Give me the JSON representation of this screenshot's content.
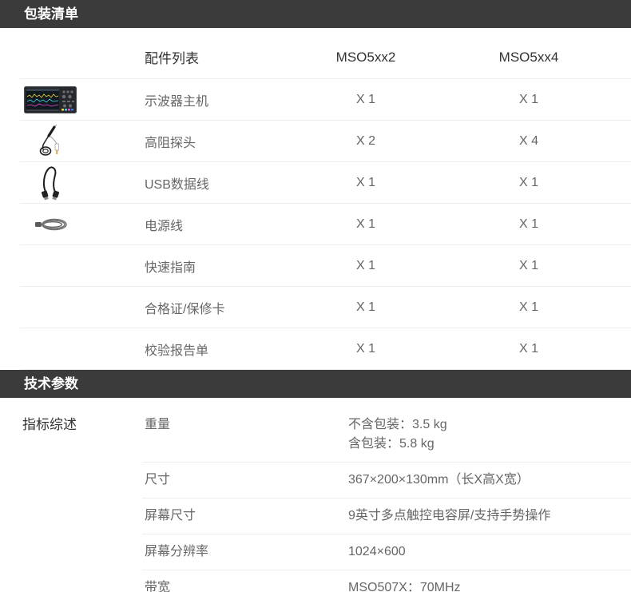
{
  "colors": {
    "section_bar": "#3b3b3b",
    "section_bar_text": "#ffffff",
    "heading_text": "#333333",
    "body_text": "#666666",
    "divider": "#eeeeee"
  },
  "packing_list": {
    "title": "包装清单",
    "header": {
      "item": "配件列表",
      "model_a": "MSO5xx2",
      "model_b": "MSO5xx4"
    },
    "rows": [
      {
        "image": "oscilloscope-image",
        "item": "示波器主机",
        "model_a": "X 1",
        "model_b": "X 1"
      },
      {
        "image": "probe-image",
        "item": "高阻探头",
        "model_a": "X 2",
        "model_b": "X 4"
      },
      {
        "image": "usb-cable-image",
        "item": "USB数据线",
        "model_a": "X 1",
        "model_b": "X 1"
      },
      {
        "image": "power-cord-image",
        "item": "电源线",
        "model_a": "X 1",
        "model_b": "X 1"
      },
      {
        "item": "快速指南",
        "model_a": "X 1",
        "model_b": "X 1"
      },
      {
        "item": "合格证/保修卡",
        "model_a": "X 1",
        "model_b": "X 1"
      },
      {
        "item": "校验报告单",
        "model_a": "X 1",
        "model_b": "X 1"
      }
    ]
  },
  "specifications": {
    "title": "技术参数",
    "group": "指标综述",
    "rows": [
      {
        "label": "重量",
        "values": [
          "不含包装：3.5 kg",
          "含包装：5.8 kg"
        ]
      },
      {
        "label": "尺寸",
        "values": [
          "367×200×130mm（长X高X宽）"
        ]
      },
      {
        "label": "屏幕尺寸",
        "values": [
          "9英寸多点触控电容屏/支持手势操作"
        ]
      },
      {
        "label": "屏幕分辨率",
        "values": [
          "1024×600"
        ]
      },
      {
        "label": "带宽",
        "values": [
          "MSO507X：70MHz"
        ]
      }
    ]
  }
}
